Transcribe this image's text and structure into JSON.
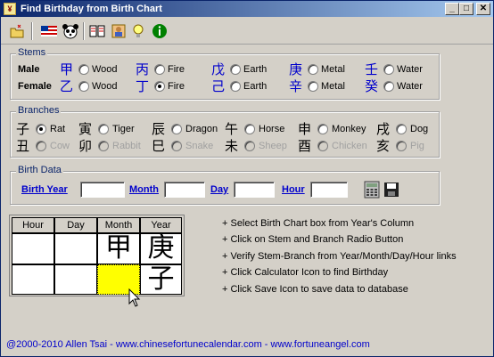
{
  "window": {
    "title": "Find Birthday from Birth Chart"
  },
  "toolbar": {
    "items": [
      "open-icon",
      "us-flag-icon",
      "panda-icon",
      "book-icon",
      "person-icon",
      "lightbulb-icon",
      "info-icon"
    ]
  },
  "stems": {
    "label": "Stems",
    "male_label": "Male",
    "female_label": "Female",
    "male": [
      {
        "char": "甲",
        "label": "Wood",
        "selected": false
      },
      {
        "char": "丙",
        "label": "Fire",
        "selected": false
      },
      {
        "char": "戊",
        "label": "Earth",
        "selected": false
      },
      {
        "char": "庚",
        "label": "Metal",
        "selected": false
      },
      {
        "char": "壬",
        "label": "Water",
        "selected": false
      }
    ],
    "female": [
      {
        "char": "乙",
        "label": "Wood",
        "selected": false
      },
      {
        "char": "丁",
        "label": "Fire",
        "selected": true
      },
      {
        "char": "己",
        "label": "Earth",
        "selected": false
      },
      {
        "char": "辛",
        "label": "Metal",
        "selected": false
      },
      {
        "char": "癸",
        "label": "Water",
        "selected": false
      }
    ]
  },
  "branches": {
    "label": "Branches",
    "row1": [
      {
        "char": "子",
        "label": "Rat",
        "selected": true,
        "enabled": true
      },
      {
        "char": "寅",
        "label": "Tiger",
        "selected": false,
        "enabled": true
      },
      {
        "char": "辰",
        "label": "Dragon",
        "selected": false,
        "enabled": true
      },
      {
        "char": "午",
        "label": "Horse",
        "selected": false,
        "enabled": true
      },
      {
        "char": "申",
        "label": "Monkey",
        "selected": false,
        "enabled": true
      },
      {
        "char": "戌",
        "label": "Dog",
        "selected": false,
        "enabled": true
      }
    ],
    "row2": [
      {
        "char": "丑",
        "label": "Cow",
        "selected": false,
        "enabled": false
      },
      {
        "char": "卯",
        "label": "Rabbit",
        "selected": false,
        "enabled": false
      },
      {
        "char": "巳",
        "label": "Snake",
        "selected": false,
        "enabled": false
      },
      {
        "char": "未",
        "label": "Sheep",
        "selected": false,
        "enabled": false
      },
      {
        "char": "酉",
        "label": "Chicken",
        "selected": false,
        "enabled": false
      },
      {
        "char": "亥",
        "label": "Pig",
        "selected": false,
        "enabled": false
      }
    ]
  },
  "birth_data": {
    "label": "Birth Data",
    "year_label": "Birth Year",
    "year_value": "",
    "month_label": "Month",
    "month_value": "",
    "day_label": "Day",
    "day_value": "",
    "hour_label": "Hour",
    "hour_value": ""
  },
  "chart": {
    "headers": [
      "Hour",
      "Day",
      "Month",
      "Year"
    ],
    "month_stem": "甲",
    "year_stem": "庚",
    "year_branch": "子",
    "highlight_color": "#ffff00"
  },
  "instructions": [
    "+ Select Birth Chart box from Year's Column",
    "+ Click on Stem and Branch Radio Button",
    "+ Verify Stem-Branch from Year/Month/Day/Hour links",
    "+ Click Calculator Icon to find Birthday",
    "+ Click Save Icon to save data to database"
  ],
  "footer": "@2000-2010 Allen Tsai - www.chinesefortunecalendar.com - www.fortuneangel.com"
}
